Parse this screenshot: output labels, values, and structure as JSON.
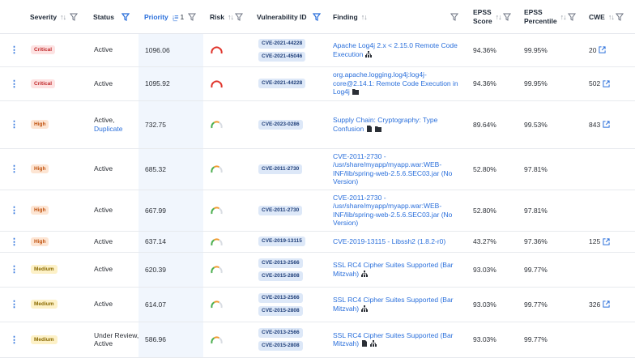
{
  "header": {
    "severity": "Severity",
    "status": "Status",
    "priority": "Priority",
    "priority_sort_order": "1",
    "risk": "Risk",
    "vulnerability_id": "Vulnerability ID",
    "finding": "Finding",
    "epss_score": "EPSS\nScore",
    "epss_percentile": "EPSS\nPercentile",
    "cwe": "CWE"
  },
  "colors": {
    "accent": "#2a6fdb",
    "critical": "#c0282a",
    "high": "#c0520f",
    "medium": "#8a6a00",
    "gauge_red": "#e0342b",
    "gauge_orange": "#f29a2e"
  },
  "rows": [
    {
      "severity": "Critical",
      "sev_class": "critical",
      "status": "Active",
      "status_extra": "",
      "priority": "1096.06",
      "risk_level": "critical",
      "cves": [
        "CVE-2021-44228",
        "CVE-2021-45046"
      ],
      "finding": "Apache Log4j 2.x < 2.15.0 Remote Code Execution",
      "finding_icons": [
        "hierarchy-icon"
      ],
      "epss_score": "94.36%",
      "epss_percentile": "99.95%",
      "cwe": "20"
    },
    {
      "severity": "Critical",
      "sev_class": "critical",
      "status": "Active",
      "status_extra": "",
      "priority": "1095.92",
      "risk_level": "critical",
      "cves": [
        "CVE-2021-44228"
      ],
      "finding": "org.apache.logging.log4j:log4j-core@2.14.1: Remote Code Execution in Log4j",
      "finding_icons": [
        "package-icon"
      ],
      "epss_score": "94.36%",
      "epss_percentile": "99.95%",
      "cwe": "502"
    },
    {
      "severity": "High",
      "sev_class": "high",
      "status": "Active,",
      "status_extra": "Duplicate",
      "priority": "732.75",
      "risk_level": "high",
      "cves": [
        "CVE-2023-0286"
      ],
      "finding": "Supply Chain: Cryptography: Type Confusion",
      "finding_icons": [
        "file-icon",
        "package-icon"
      ],
      "epss_score": "89.64%",
      "epss_percentile": "99.53%",
      "cwe": "843"
    },
    {
      "severity": "High",
      "sev_class": "high",
      "status": "Active",
      "status_extra": "",
      "priority": "685.32",
      "risk_level": "high",
      "cves": [
        "CVE-2011-2730"
      ],
      "finding": "CVE-2011-2730 - /usr/share/myapp/myapp.war:WEB-INF/lib/spring-web-2.5.6.SEC03.jar (No Version)",
      "finding_icons": [],
      "epss_score": "52.80%",
      "epss_percentile": "97.81%",
      "cwe": ""
    },
    {
      "severity": "High",
      "sev_class": "high",
      "status": "Active",
      "status_extra": "",
      "priority": "667.99",
      "risk_level": "high",
      "cves": [
        "CVE-2011-2730"
      ],
      "finding": "CVE-2011-2730 - /usr/share/myapp/myapp.war:WEB-INF/lib/spring-web-2.5.6.SEC03.jar (No Version)",
      "finding_icons": [],
      "epss_score": "52.80%",
      "epss_percentile": "97.81%",
      "cwe": ""
    },
    {
      "severity": "High",
      "sev_class": "high",
      "status": "Active",
      "status_extra": "",
      "priority": "637.14",
      "risk_level": "high",
      "cves": [
        "CVE-2019-13115"
      ],
      "finding": "CVE-2019-13115 - Libssh2 (1.8.2-r0)",
      "finding_icons": [],
      "epss_score": "43.27%",
      "epss_percentile": "97.36%",
      "cwe": "125"
    },
    {
      "severity": "Medium",
      "sev_class": "medium",
      "status": "Active",
      "status_extra": "",
      "priority": "620.39",
      "risk_level": "high",
      "cves": [
        "CVE-2013-2566",
        "CVE-2015-2808"
      ],
      "finding": "SSL RC4 Cipher Suites Supported (Bar Mitzvah)",
      "finding_icons": [
        "hierarchy-icon"
      ],
      "epss_score": "93.03%",
      "epss_percentile": "99.77%",
      "cwe": ""
    },
    {
      "severity": "Medium",
      "sev_class": "medium",
      "status": "Active",
      "status_extra": "",
      "priority": "614.07",
      "risk_level": "high",
      "cves": [
        "CVE-2013-2566",
        "CVE-2015-2808"
      ],
      "finding": "SSL RC4 Cipher Suites Supported (Bar Mitzvah)",
      "finding_icons": [
        "hierarchy-icon"
      ],
      "epss_score": "93.03%",
      "epss_percentile": "99.77%",
      "cwe": "326"
    },
    {
      "severity": "Medium",
      "sev_class": "medium",
      "status": "Under Review,\nActive",
      "status_extra": "",
      "priority": "586.96",
      "risk_level": "high",
      "cves": [
        "CVE-2013-2566",
        "CVE-2015-2808"
      ],
      "finding": "SSL RC4 Cipher Suites Supported (Bar Mitzvah)",
      "finding_icons": [
        "file-icon",
        "hierarchy-icon"
      ],
      "epss_score": "93.03%",
      "epss_percentile": "99.77%",
      "cwe": ""
    }
  ]
}
